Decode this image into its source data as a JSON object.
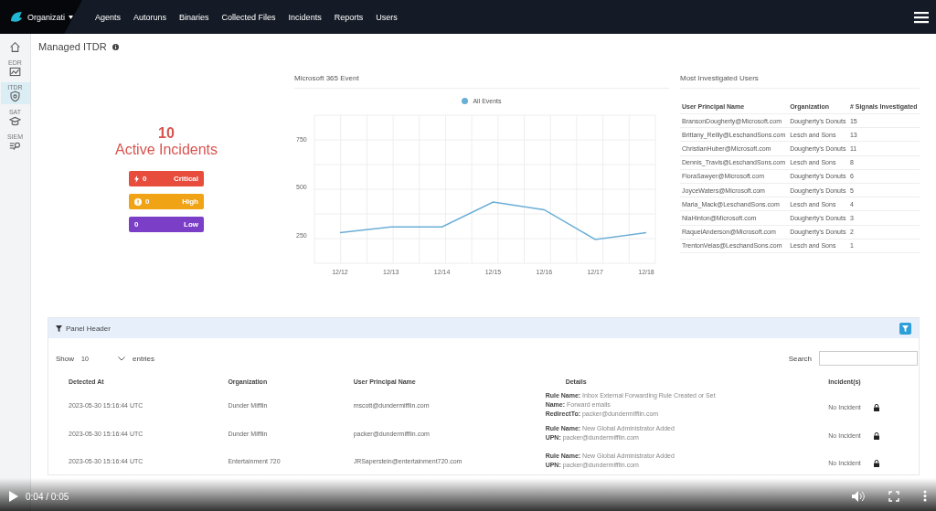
{
  "nav": {
    "org": "Organizati",
    "items": [
      {
        "label": "Agents",
        "selected": false
      },
      {
        "label": "Autoruns",
        "selected": false
      },
      {
        "label": "Binaries",
        "selected": false
      },
      {
        "label": "Collected Files",
        "selected": false
      },
      {
        "label": "Incidents",
        "selected": false
      },
      {
        "label": "Reports",
        "selected": false
      },
      {
        "label": "Users",
        "selected": false
      }
    ]
  },
  "sidebar": [
    {
      "kind": "home",
      "selected": false
    },
    {
      "kind": "edr",
      "label": "EDR",
      "selected": false
    },
    {
      "kind": "itdr",
      "label": "ITDR",
      "selected": true
    },
    {
      "kind": "sat",
      "label": "SAT",
      "selected": false
    },
    {
      "kind": "siem",
      "label": "SIEM",
      "selected": false
    }
  ],
  "page_title": "Managed ITDR",
  "incidents": {
    "count": "10",
    "label": "Active Incidents",
    "levels": [
      {
        "kind": "critical",
        "count": "0",
        "label": "Critical"
      },
      {
        "kind": "high",
        "count": "0",
        "label": "High"
      },
      {
        "kind": "low",
        "count": "0",
        "label": "Low"
      }
    ]
  },
  "event_chart": {
    "title": "Microsoft 365 Event",
    "chart_data": {
      "type": "line",
      "categories": [
        "12/12",
        "12/13",
        "12/14",
        "12/15",
        "12/16",
        "12/17",
        "12/18"
      ],
      "series": [
        {
          "name": "All Events",
          "color": "#6aaed6",
          "values": [
            260,
            290,
            290,
            420,
            380,
            225,
            260
          ]
        }
      ],
      "ylim": [
        100,
        875
      ],
      "yticks": [
        250,
        500,
        750
      ],
      "grid": true
    }
  },
  "most_investigated": {
    "title": "Most Investigated Users",
    "columns": [
      "User Principal Name",
      "Organization",
      "# Signals Investigated"
    ],
    "rows": [
      [
        "BransonDougherty@Microsoft.com",
        "Dougherty's Donuts",
        "15"
      ],
      [
        "Brittany_Reilly@LeschandSons.com",
        "Lesch and Sons",
        "13"
      ],
      [
        "ChristianHuber@Microsoft.com",
        "Dougherty's Donuts",
        "11"
      ],
      [
        "Dennis_Travis@LeschandSons.com",
        "Lesch and Sons",
        "8"
      ],
      [
        "FloraSawyer@Microsoft.com",
        "Dougherty's Donuts",
        "6"
      ],
      [
        "JoyceWaters@Microsoft.com",
        "Dougherty's Donuts",
        "5"
      ],
      [
        "Maria_Mack@LeschandSons.com",
        "Lesch and Sons",
        "4"
      ],
      [
        "NiaHinton@Microsoft.com",
        "Dougherty's Donuts",
        "3"
      ],
      [
        "RaquelAnderson@Microsoft.com",
        "Dougherty's Donuts",
        "2"
      ],
      [
        "TrentonVelas@LeschandSons.com",
        "Lesch and Sons",
        "1"
      ]
    ]
  },
  "panel": {
    "title": "Panel Header",
    "show_label": "Show",
    "page_size": "10",
    "entries_label": "entries",
    "search_label": "Search",
    "columns": [
      "Detected At",
      "Organization",
      "User Principal Name",
      "Details",
      "Incident(s)"
    ],
    "rows": [
      {
        "detected": "2023-05-30 15:16:44 UTC",
        "org": "Dunder Mifflin",
        "upn": "mscott@dundermifflin.com",
        "details": [
          "**Rule Name:** Inbox External Forwarding Rule Created or Set",
          "**Name:** Forward emails",
          "**RedirectTo:** packer@dundermifflin.com"
        ],
        "incident": "No Incident"
      },
      {
        "detected": "2023-05-30 15:16:44 UTC",
        "org": "Dunder Mifflin",
        "upn": "packer@dundermifflin.com",
        "details": [
          "**Rule Name:** New Global Administrator Added",
          "**UPN:** packer@dundermifflin.com"
        ],
        "incident": "No Incident"
      },
      {
        "detected": "2023-05-30 15:16:44 UTC",
        "org": "Entertainment 720",
        "upn": "JRSaperstein@entertainment720.com",
        "details": [
          "**Rule Name:** New Global Administrator Added",
          "**UPN:** packer@dundermifflin.com"
        ],
        "incident": "No Incident"
      }
    ]
  },
  "video": {
    "time": "0:04 / 0:05"
  }
}
